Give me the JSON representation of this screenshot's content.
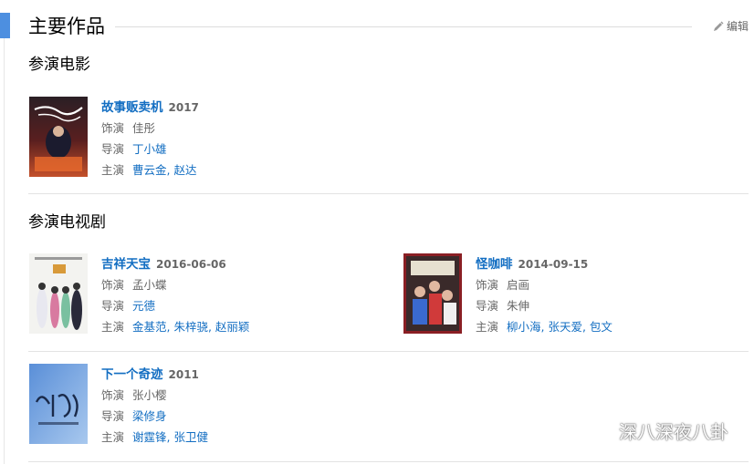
{
  "header": {
    "title": "主要作品",
    "edit_label": "编辑"
  },
  "sections": {
    "films": {
      "title": "参演电影",
      "works": [
        {
          "title": "故事贩卖机",
          "year": "2017",
          "role_label": "饰演",
          "role": "佳彤",
          "director_label": "导演",
          "director": "丁小雄",
          "cast_label": "主演",
          "cast": "曹云金, 赵达"
        }
      ]
    },
    "tv": {
      "title": "参演电视剧",
      "works": [
        {
          "title": "吉祥天宝",
          "year": "2016-06-06",
          "role_label": "饰演",
          "role": "孟小蝶",
          "director_label": "导演",
          "director": "元德",
          "cast_label": "主演",
          "cast": "金基范, 朱梓骁, 赵丽颖"
        },
        {
          "title": "怪咖啡",
          "year": "2014-09-15",
          "role_label": "饰演",
          "role": "启画",
          "director_label": "导演",
          "director": "朱伸",
          "cast_label": "主演",
          "cast": "柳小海, 张天爱, 包文"
        },
        {
          "title": "下一个奇迹",
          "year": "2011",
          "role_label": "饰演",
          "role": "张小樱",
          "director_label": "导演",
          "director": "梁修身",
          "cast_label": "主演",
          "cast": "谢霆锋, 张卫健"
        }
      ]
    }
  },
  "watermark": {
    "text": "深八深夜八卦"
  },
  "colors": {
    "link": "#136ec2",
    "accent_bar": "#4d8fe0",
    "muted": "#666666"
  }
}
